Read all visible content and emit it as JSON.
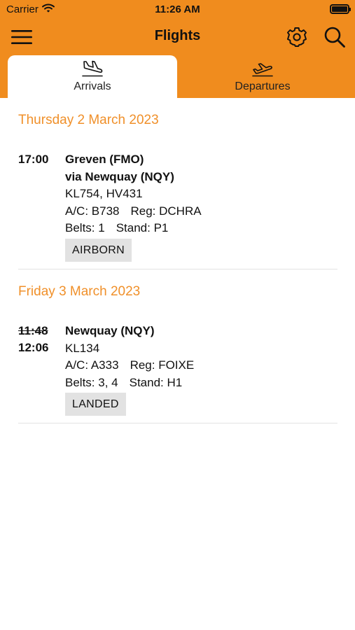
{
  "status_bar": {
    "carrier": "Carrier",
    "time": "11:26 AM"
  },
  "nav": {
    "title": "Flights",
    "icons": {
      "menu": "hamburger-menu-icon",
      "settings": "gear-icon",
      "search": "search-icon"
    }
  },
  "tabs": [
    {
      "label": "Arrivals",
      "icon": "plane-landing-icon",
      "selected": true
    },
    {
      "label": "Departures",
      "icon": "plane-takeoff-icon",
      "selected": false
    }
  ],
  "colors": {
    "brand": "#F08C1E",
    "day_header": "#F0902A",
    "badge_bg": "#E2E2E2",
    "divider": "#E3E3E3"
  },
  "days": [
    {
      "date": "Thursday 2 March 2023",
      "flights": [
        {
          "time": "17:00",
          "origin": "Greven (FMO)",
          "via": "via Newquay (NQY)",
          "flight_numbers": "KL754, HV431",
          "aircraft": "A/C: B738",
          "registration": "Reg: DCHRA",
          "belts": "Belts: 1",
          "stand": "Stand: P1",
          "status": "AIRBORN"
        }
      ]
    },
    {
      "date": "Friday 3 March 2023",
      "flights": [
        {
          "scheduled_time": "11:48",
          "time": "12:06",
          "origin": "Newquay (NQY)",
          "flight_numbers": "KL134",
          "aircraft": "A/C: A333",
          "registration": "Reg: FOIXE",
          "belts": "Belts: 3, 4",
          "stand": "Stand: H1",
          "status": "LANDED"
        }
      ]
    }
  ]
}
